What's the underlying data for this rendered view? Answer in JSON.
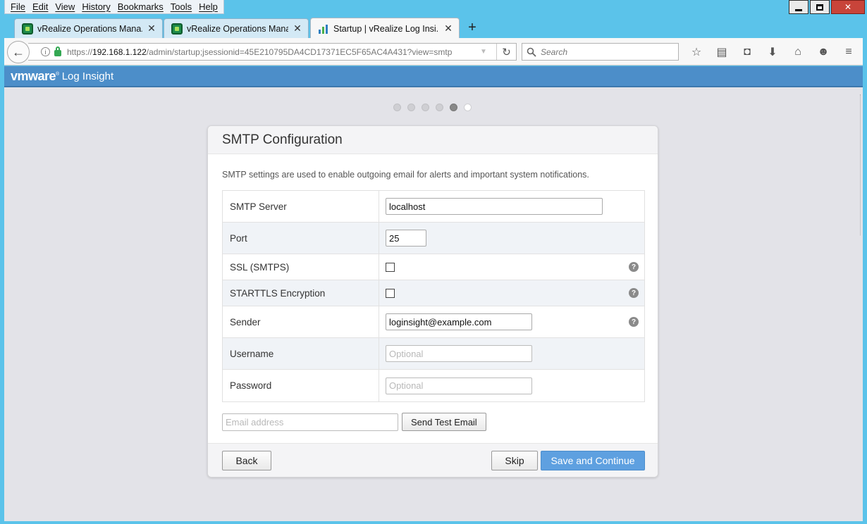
{
  "menubar": {
    "items": [
      "File",
      "Edit",
      "View",
      "History",
      "Bookmarks",
      "Tools",
      "Help"
    ]
  },
  "window": {
    "min_icon": "minimize-icon",
    "max_icon": "maximize-icon",
    "close_icon": "close-icon",
    "close_glyph": "✕"
  },
  "tabs": [
    {
      "title": "vRealize Operations Mana...",
      "close": "✕",
      "icon": "vrops-favicon"
    },
    {
      "title": "vRealize Operations Mana...",
      "close": "✕",
      "icon": "vrops-favicon"
    },
    {
      "title": "Startup | vRealize Log Insi...",
      "close": "✕",
      "icon": "log-insight-favicon",
      "active": true
    }
  ],
  "new_tab": "+",
  "nav": {
    "back": "←",
    "url_prefix": "https://",
    "url_host": "192.168.1.122",
    "url_path": "/admin/startup;jsessionid=45E210795DA4CD17371EC5F65AC4A431?view=smtp",
    "reload": "↻",
    "search_placeholder": "Search",
    "toolbar_icons": [
      "☆",
      "▤",
      "◘",
      "⬇",
      "⌂",
      "☻",
      "≡"
    ]
  },
  "header": {
    "brand": "vmware",
    "brand_mark": "®",
    "product": "Log Insight"
  },
  "wizard": {
    "steps": 6,
    "current_step": 6,
    "completed_step": 5
  },
  "card": {
    "title": "SMTP Configuration",
    "description": "SMTP settings are used to enable outgoing email for alerts and important system notifications.",
    "fields": {
      "smtp_server": {
        "label": "SMTP Server",
        "value": "localhost"
      },
      "port": {
        "label": "Port",
        "value": "25"
      },
      "ssl": {
        "label": "SSL (SMTPS)",
        "checked": false
      },
      "starttls": {
        "label": "STARTTLS Encryption",
        "checked": false
      },
      "sender": {
        "label": "Sender",
        "value": "loginsight@example.com"
      },
      "username": {
        "label": "Username",
        "value": "",
        "placeholder": "Optional"
      },
      "password": {
        "label": "Password",
        "value": "",
        "placeholder": "Optional"
      }
    },
    "help_glyph": "?",
    "test_email": {
      "placeholder": "Email address",
      "button": "Send Test Email"
    },
    "footer": {
      "back": "Back",
      "skip": "Skip",
      "save": "Save and Continue"
    }
  },
  "colors": {
    "desktop": "#5bc3ea",
    "header_bar": "#4c8ec9",
    "primary_button": "#5ea0e0",
    "page_bg": "#e3e3e8"
  }
}
